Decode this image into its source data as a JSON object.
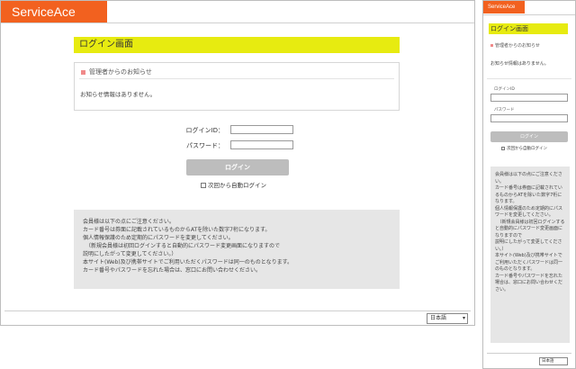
{
  "brand": {
    "name": "ServiceAce",
    "color": "#f2611f"
  },
  "page": {
    "title": "ログイン画面",
    "accent": "#e7eb10"
  },
  "notice": {
    "header": "管理者からのお知らせ",
    "body": "お知らせ情報はありません。"
  },
  "form": {
    "login_id_label": "ログインID：",
    "password_label": "パスワード：",
    "login_id_label_mobile": "ログインID",
    "password_label_mobile": "パスワード",
    "login_id_value": "",
    "password_value": "",
    "login_button": "ログイン",
    "auto_login": "次回から自動ログイン"
  },
  "info": {
    "lines": [
      "会員様は以下の点にご注意ください。",
      "カード番号は券面に記載されているものからATを除いた数字7桁になります。",
      "個人情報保護のため定期的にパスワードを変更してください。",
      "　（新規会員様は初回ログインすると自動的にパスワード変更画面になりますので",
      "説明にしたがって変更してください。）",
      "本サイト(Web)及び携帯サイトでご利用いただくパスワードは同一のものとなります。",
      "カード番号やパスワードを忘れた場合は、窓口にお問い合わせください。"
    ]
  },
  "language": {
    "selected": "日本語"
  }
}
